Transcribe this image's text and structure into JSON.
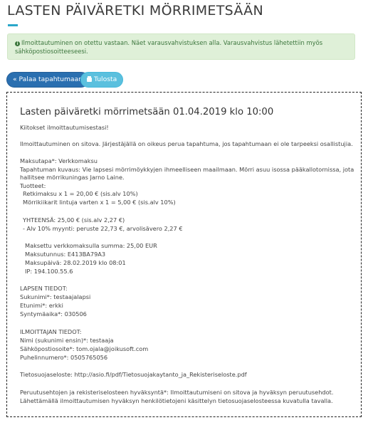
{
  "page": {
    "title": "LASTEN PÄIVÄRETKI MÖRRIMETSÄÄN"
  },
  "alert": {
    "icon": "info-icon",
    "text_line1": "Ilmoittautuminen on otettu vastaan. Näet varausvahvistuksen alla. Varausvahvistus lähetettiin myös",
    "text_line2": "sähköpostiosoitteeseesi."
  },
  "actions": {
    "back_label": "« Palaa tapahtumaan",
    "print_label": "Tulosta"
  },
  "receipt": {
    "title": "Lasten päiväretki mörrimetsään 01.04.2019 klo 10:00",
    "thanks": "Kiitokset ilmoittautumisestasi!",
    "binding": "Ilmoittautuminen on sitova. Järjestäjällä on oikeus perua tapahtuma, jos tapahtumaan ei ole tarpeeksi osallistujia.",
    "payment_method": "Maksutapa*: Verkkomaksu",
    "event_desc_1": "Tapahtuman kuvaus: Vie lapsesi mörrimöykkyjen ihmeelliseen maailmaan. Mörri asuu isossa pääkallotornissa, jota",
    "event_desc_2": "hallitsee mörrikuningas Jarno Laine.",
    "products_label": "Tuotteet:",
    "product_1": "Retkimaksu x 1 = 20,00 € (sis.alv 10%)",
    "product_2": "Mörrikiikarit lintuja varten x 1 = 5,00 € (sis.alv 10%)",
    "total": "YHTEENSÄ: 25,00 € (sis.alv 2,27 €)",
    "vat_breakdown": "- Alv 10% myynti: peruste 22,73 €, arvolisävero 2,27 €",
    "paid_amount": "Maksettu verkkomaksulla summa: 25,00 EUR",
    "payment_id": "Maksutunnus: E413BA79A3",
    "payment_date": "Maksupäivä: 28.02.2019 klo 08:01",
    "ip": "IP: 194.100.55.6",
    "child_header": "LAPSEN TIEDOT:",
    "child_surname": "Sukunimi*: testaajalapsi",
    "child_firstname": "Etunimi*: erkki",
    "child_birthdate": "Syntymäaika*: 030506",
    "guardian_header": "ILMOITTAJAN TIEDOT:",
    "guardian_name": "Nimi (sukunimi ensin)*: testaaja",
    "guardian_email": "Sähköpostiosoite*: tom.ojala@joikusoft.com",
    "guardian_phone": "Puhelinnumero*: 0505765056",
    "privacy": "Tietosuojaseloste: http://asio.fi/pdf/Tietosuojakaytanto_ja_Rekisteriseloste.pdf",
    "consent_1": "Peruutusehtojen ja rekisteriselosteen hyväksyntä*: Ilmoittautumiseni on sitova ja hyväksyn peruutusehdot.",
    "consent_2": "Lähettämällä ilmoittautumisen hyväksyn henkilötietojeni käsittelyn tietosuojaselosteessa kuvatulla tavalla."
  }
}
